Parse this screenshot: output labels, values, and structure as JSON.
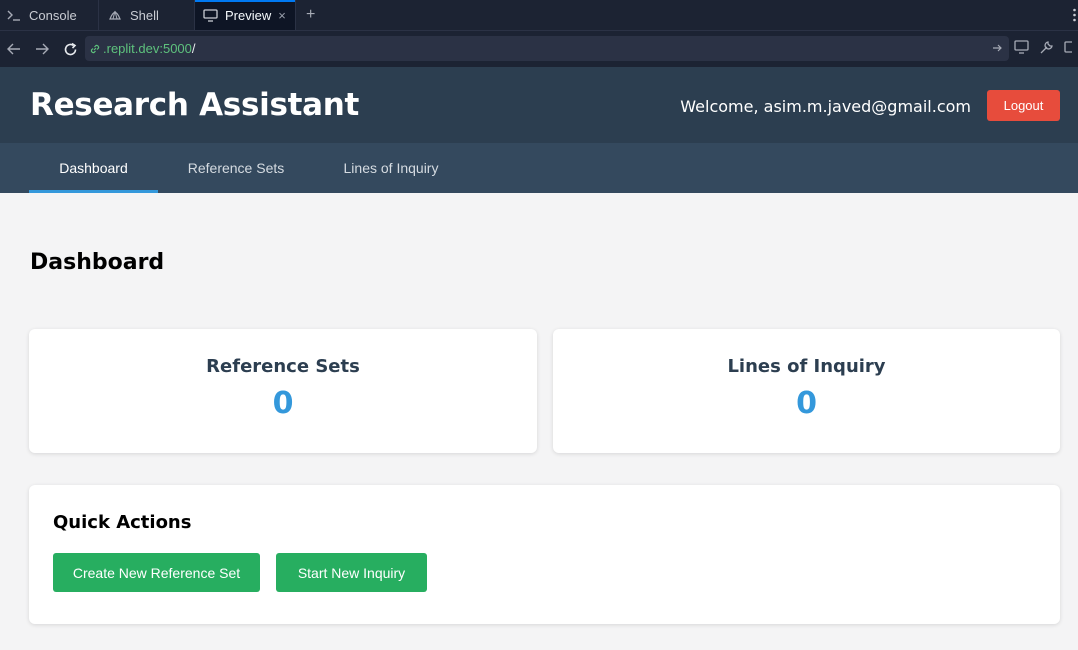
{
  "ide": {
    "tabs": [
      {
        "label": "Console",
        "icon": "terminal-icon"
      },
      {
        "label": "Shell",
        "icon": "shell-icon"
      },
      {
        "label": "Preview",
        "icon": "monitor-icon",
        "active": true
      }
    ],
    "close_glyph": "×",
    "new_tab_glyph": "+",
    "url": {
      "host": ".replit.dev:5000",
      "path": "/"
    }
  },
  "app": {
    "title": "Research Assistant",
    "welcome_text": "Welcome, asim.m.javed@gmail.com",
    "logout_label": "Logout",
    "nav": [
      {
        "label": "Dashboard",
        "active": true
      },
      {
        "label": "Reference Sets"
      },
      {
        "label": "Lines of Inquiry"
      }
    ],
    "page_title": "Dashboard",
    "stats": [
      {
        "label": "Reference Sets",
        "value": "0"
      },
      {
        "label": "Lines of Inquiry",
        "value": "0"
      }
    ],
    "quick_actions": {
      "title": "Quick Actions",
      "buttons": [
        "Create New Reference Set",
        "Start New Inquiry"
      ]
    }
  },
  "colors": {
    "header_bg": "#2c3e50",
    "nav_bg": "#34495e",
    "accent_blue": "#3498db",
    "logout_red": "#e74c3c",
    "action_green": "#27ae60"
  }
}
